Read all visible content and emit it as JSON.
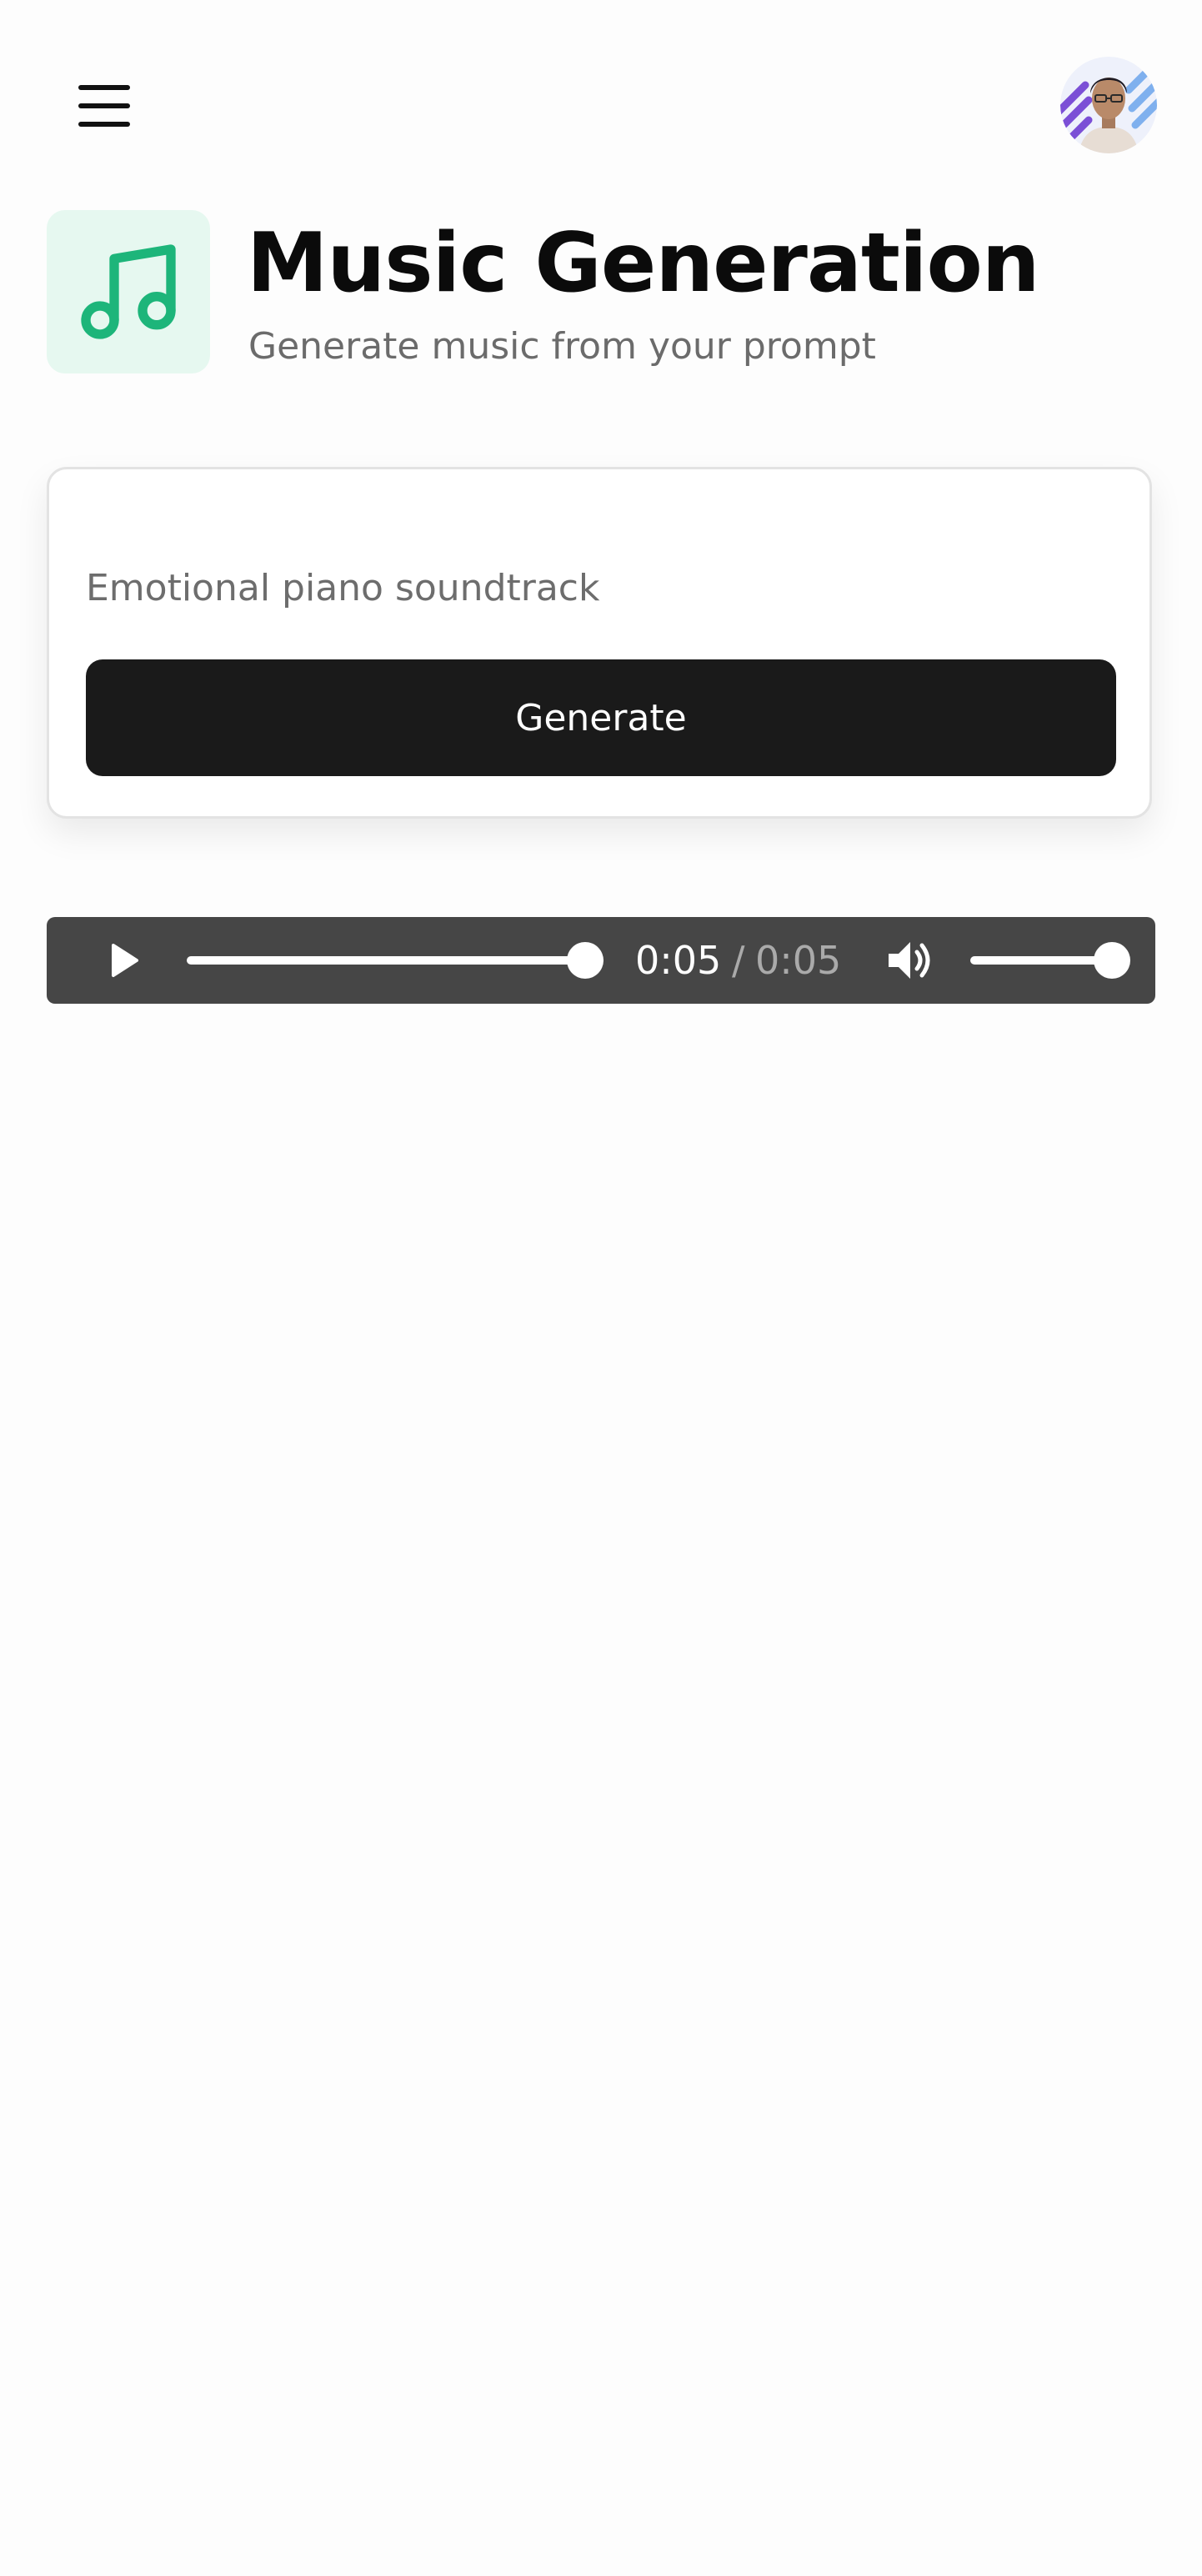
{
  "header": {
    "title": "Music Generation",
    "subtitle": "Generate music from your prompt",
    "icon": "music-note-icon"
  },
  "topbar": {
    "menu_icon": "hamburger-menu-icon",
    "avatar": "user-avatar"
  },
  "form": {
    "prompt_placeholder": "Emotional piano soundtrack",
    "prompt_value": "",
    "generate_label": "Generate"
  },
  "player": {
    "current_time": "0:05",
    "separator": "/",
    "total_time": "0:05",
    "progress": 1.0,
    "volume": 1.0,
    "play_icon": "play-icon",
    "volume_icon": "volume-icon"
  },
  "colors": {
    "accent": "#1db57a",
    "accent_bg": "#e6f8f0",
    "button_bg": "#1a1a1a",
    "player_bg": "#464646"
  }
}
